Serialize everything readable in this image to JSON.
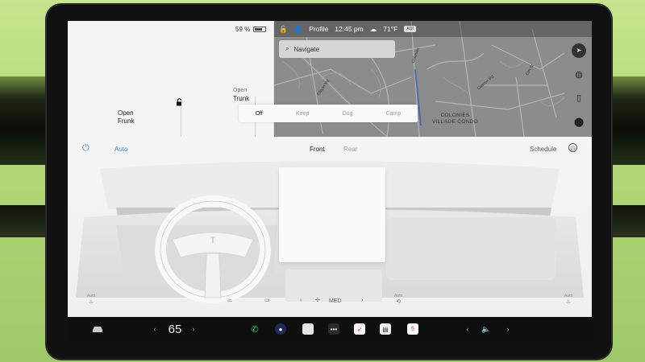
{
  "status": {
    "battery_percent": "59 %",
    "profile": "Profile",
    "time": "12:45 pm",
    "temperature": "71°F",
    "aqi": "AQI"
  },
  "car": {
    "frunk_label_line1": "Open",
    "frunk_label_line2": "Frunk",
    "trunk_label_line1": "Open",
    "trunk_label_line2": "Trunk"
  },
  "map": {
    "search_placeholder": "Navigate",
    "area_label": "COLONIES\nVILLAGE CONDO",
    "streets": [
      "Colonies",
      "Ellison Rd",
      "Gascon Rd",
      "Elm St"
    ]
  },
  "modes": {
    "options": [
      "Off",
      "Keep",
      "Dog",
      "Camp"
    ],
    "active": "Off"
  },
  "climate": {
    "auto_label": "Auto",
    "front_label": "Front",
    "rear_label": "Rear",
    "schedule_label": "Schedule",
    "fan_level": "MED",
    "seat_left_mode": "Auto",
    "seat_right_mode": "Auto",
    "recirc_mode": "Auto"
  },
  "taskbar": {
    "driver_temp": "65",
    "calendar_day": "5"
  },
  "colors": {
    "accent_blue": "#3b82f6",
    "phone_green": "#22c55e",
    "calendar_red": "#e11d48"
  }
}
